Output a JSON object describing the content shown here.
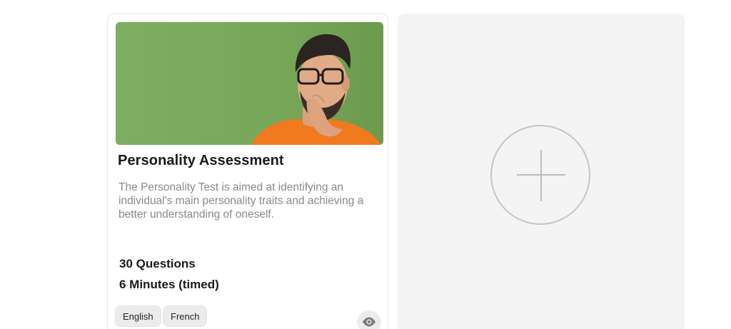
{
  "assessment_card": {
    "title": "Personality Assessment",
    "description": "The Personality Test is aimed at identifying an individual's main personality traits and achieving a better understanding of oneself.",
    "questions": "30 Questions",
    "duration": "6 Minutes (timed)",
    "languages": [
      "English",
      "French"
    ],
    "image": "man-thinking-photo",
    "preview_icon": "eye-icon"
  },
  "add_card": {
    "icon": "plus-circle-icon"
  },
  "colors": {
    "image_background": "#7cab5f",
    "shirt": "#f07a1e",
    "add_card_background": "#f4f4f4",
    "pill_background": "#ececec"
  }
}
